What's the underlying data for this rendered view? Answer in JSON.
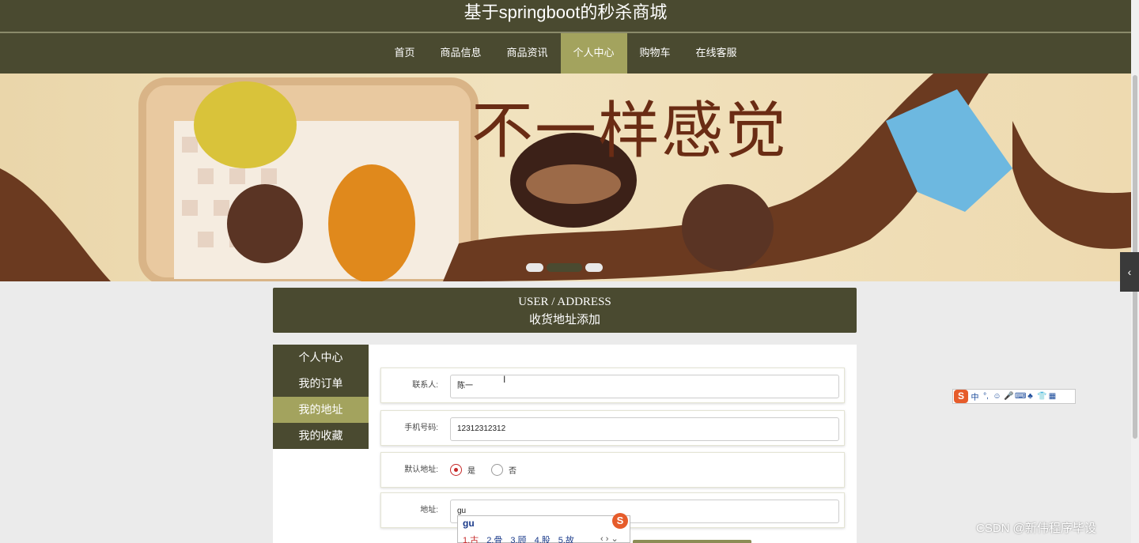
{
  "site": {
    "title": "基于springboot的秒杀商城"
  },
  "nav": {
    "items": [
      {
        "label": "首页"
      },
      {
        "label": "商品信息"
      },
      {
        "label": "商品资讯"
      },
      {
        "label": "个人中心",
        "active": true
      },
      {
        "label": "购物车"
      },
      {
        "label": "在线客服"
      }
    ]
  },
  "banner": {
    "text": "不一样感觉",
    "slides": 3,
    "active_slide": 2
  },
  "section": {
    "title_en": "USER / ADDRESS",
    "title_cn": "收货地址添加"
  },
  "sidebar": {
    "items": [
      {
        "label": "个人中心"
      },
      {
        "label": "我的订单"
      },
      {
        "label": "我的地址",
        "active": true
      },
      {
        "label": "我的收藏"
      }
    ]
  },
  "form": {
    "contact_label": "联系人:",
    "contact_value": "陈一",
    "phone_label": "手机号码:",
    "phone_value": "12312312312",
    "default_label": "默认地址:",
    "default_yes": "是",
    "default_no": "否",
    "address_label": "地址:",
    "address_value": "gu"
  },
  "ime_popup": {
    "input": "gu",
    "candidates": [
      "1.古",
      "2.骨",
      "3.顾",
      "4.股",
      "5.故"
    ],
    "nav": "‹ › ⌄",
    "logo": "S"
  },
  "ime_toolbar": {
    "logo": "S",
    "items": [
      "中",
      "°,",
      "☺",
      "🎤",
      "⌨",
      "♣",
      "👕",
      "▦"
    ]
  },
  "watermark": {
    "text": "CSDN @新伟程序毕设"
  },
  "colors": {
    "primary": "#4a4a30",
    "accent": "#a3a35e",
    "radio_checked": "#c62828"
  }
}
